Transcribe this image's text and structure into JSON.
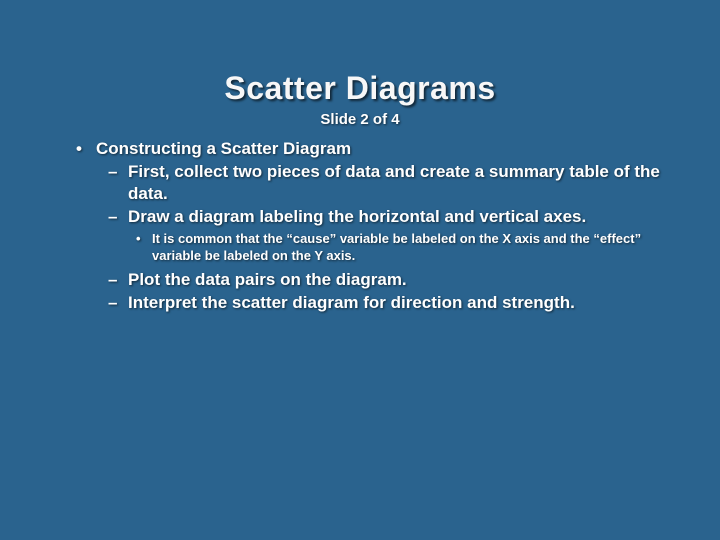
{
  "slide": {
    "title": "Scatter Diagrams",
    "subtitle": "Slide 2 of 4",
    "bullets": {
      "l1_0": "Constructing a Scatter Diagram",
      "l2_0": "First, collect two pieces of data and create a summary table of the data.",
      "l2_1": "Draw a diagram labeling the horizontal and vertical axes.",
      "l3_0": "It is common that the “cause” variable be labeled on the X axis and the “effect” variable be labeled on the Y axis.",
      "l2_2": "Plot the data pairs on the diagram.",
      "l2_3": "Interpret the scatter diagram for direction and strength."
    }
  }
}
